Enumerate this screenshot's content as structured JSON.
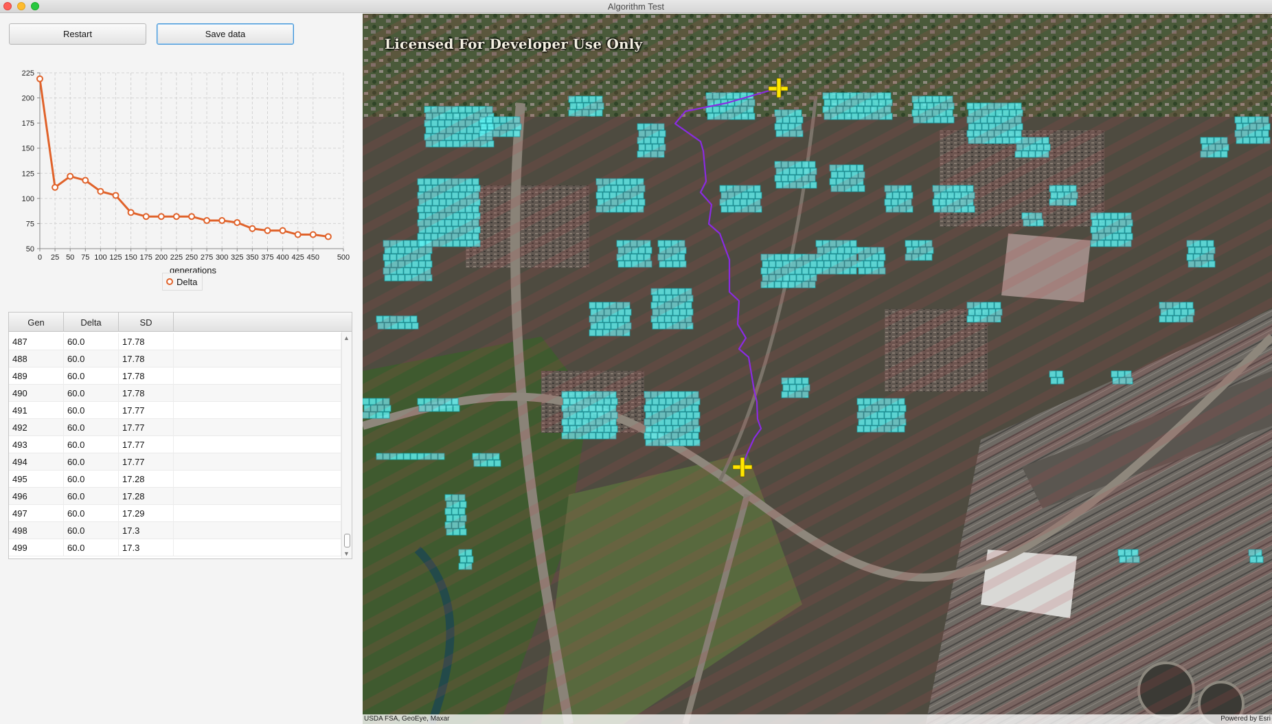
{
  "window": {
    "title": "Algorithm Test"
  },
  "toolbar": {
    "restart_label": "Restart",
    "save_label": "Save data"
  },
  "colors": {
    "series": "#e0622a",
    "accent_focus": "#3a91d6",
    "buildings": "#43e8e8",
    "route": "#8a2be2",
    "markers": "#ffe600"
  },
  "chart_data": {
    "type": "line",
    "title": "",
    "xlabel": "generations",
    "ylabel": "",
    "xlim": [
      0,
      500
    ],
    "ylim": [
      50,
      225
    ],
    "xticks": [
      0,
      25,
      50,
      75,
      100,
      125,
      150,
      175,
      200,
      225,
      250,
      275,
      300,
      325,
      350,
      375,
      400,
      425,
      450,
      500
    ],
    "yticks": [
      50,
      75,
      100,
      125,
      150,
      175,
      200,
      225
    ],
    "grid": true,
    "legend_position": "bottom",
    "series": [
      {
        "name": "Delta",
        "x": [
          0,
          25,
          50,
          75,
          100,
          125,
          150,
          175,
          200,
          225,
          250,
          275,
          300,
          325,
          350,
          375,
          400,
          425,
          450,
          475
        ],
        "values": [
          219,
          111,
          122,
          118,
          107,
          103,
          86,
          82,
          82,
          82,
          82,
          78,
          78,
          76,
          70,
          68,
          68,
          64,
          64,
          62
        ]
      }
    ]
  },
  "table": {
    "columns": [
      "Gen",
      "Delta",
      "SD"
    ],
    "rows": [
      [
        "487",
        "60.0",
        "17.78"
      ],
      [
        "488",
        "60.0",
        "17.78"
      ],
      [
        "489",
        "60.0",
        "17.78"
      ],
      [
        "490",
        "60.0",
        "17.78"
      ],
      [
        "491",
        "60.0",
        "17.77"
      ],
      [
        "492",
        "60.0",
        "17.77"
      ],
      [
        "493",
        "60.0",
        "17.77"
      ],
      [
        "494",
        "60.0",
        "17.77"
      ],
      [
        "495",
        "60.0",
        "17.28"
      ],
      [
        "496",
        "60.0",
        "17.28"
      ],
      [
        "497",
        "60.0",
        "17.29"
      ],
      [
        "498",
        "60.0",
        "17.3"
      ],
      [
        "499",
        "60.0",
        "17.3"
      ]
    ]
  },
  "map": {
    "license_text": "Licensed For Developer Use Only",
    "attribution_left": "USDA FSA, GeoEye, Maxar",
    "attribution_right": "Powered by Esri"
  }
}
